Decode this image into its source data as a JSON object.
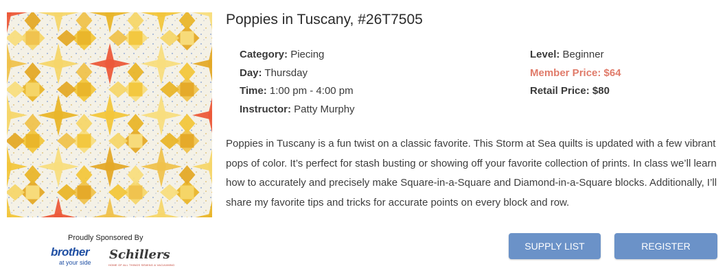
{
  "class": {
    "title": "Poppies in Tuscany, #26T7505",
    "category_label": "Category:",
    "category": "Piecing",
    "day_label": "Day:",
    "day": "Thursday",
    "time_label": "Time:",
    "time": "1:00 pm - 4:00 pm",
    "instructor_label": "Instructor:",
    "instructor": "Patty Murphy",
    "level_label": "Level:",
    "level": "Beginner",
    "member_price_label": "Member Price:",
    "member_price": "$64",
    "retail_price_label": "Retail Price:",
    "retail_price": "$80",
    "description": "Poppies in Tuscany is a fun twist on a classic favorite. This Storm at Sea quilts is updated with a few vibrant pops of color. It’s perfect for stash busting or showing off your favorite collection of prints. In class we’ll learn how to accurately and precisely make Square-in-a-Square and Diamond-in-a-Square blocks. Additionally, I’ll share my favorite tips and tricks for accurate points on every block and row."
  },
  "sponsor": {
    "label": "Proudly Sponsored By",
    "brother": "brother",
    "brother_tagline": "at your side",
    "schillers": "Schillers",
    "schillers_tagline": "HOME OF ALL THINGS SEWING & VACUUMING"
  },
  "buttons": {
    "supply_list": "SUPPLY LIST",
    "register": "REGISTER"
  },
  "colors": {
    "button": "#6b92c8",
    "member_price": "#e07b6a",
    "quilt_yellow": "#f2c63c",
    "quilt_red": "#ec5a3a"
  }
}
